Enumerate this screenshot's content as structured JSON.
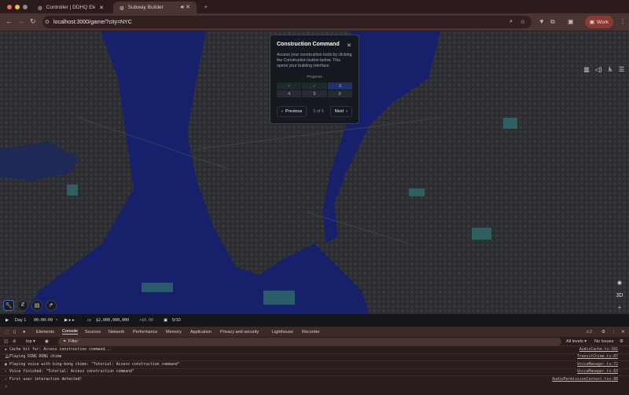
{
  "browser": {
    "tabs": [
      {
        "title": "Controller | DDHQ Election Vi",
        "active": false
      },
      {
        "title": "Subway Builder",
        "active": true
      }
    ],
    "url": "localhost:3000/game/?city=NYC",
    "profile": "Work"
  },
  "tutorial": {
    "title": "Construction Command",
    "body": "Access your construction tools by clicking the Construction button below. This opens your building interface.",
    "progress_label": "Progress",
    "steps": [
      "✓",
      "✓",
      "3",
      "4",
      "5",
      "6"
    ],
    "current_step": 3,
    "total_steps": 6,
    "counter": "3 of 6",
    "prev": "Previous",
    "next": "Next"
  },
  "map_controls": {
    "view_3d": "3D",
    "zoom_in": "+",
    "zoom_out": "−"
  },
  "status": {
    "day": "Day 1",
    "time": "00:00:00",
    "money": "$2,000,000,000",
    "delta": "+$0.00",
    "ridership": "5/10"
  },
  "devtools": {
    "tabs": [
      "Elements",
      "Console",
      "Sources",
      "Network",
      "Performance",
      "Memory",
      "Application",
      "Privacy and security",
      "Lighthouse",
      "Recorder"
    ],
    "warnings": "2",
    "context": "top ▾",
    "filter_placeholder": "Filter",
    "levels": "All levels ▾",
    "issues": "No Issues",
    "logs": [
      {
        "msg": "Cache hit for: Access construction command...",
        "src": "AudioCache.ts:101"
      },
      {
        "msg": "Playing DING DONG chime",
        "src": "TransitChime.ts:87"
      },
      {
        "msg": "Playing voice with bing-bong chime: \"Tutorial: Access construction command\"",
        "src": "VoiceManager.ts:72"
      },
      {
        "msg": "Voice finished: \"Tutorial: Access construction command\"",
        "src": "VoiceManager.ts:83"
      },
      {
        "msg": "First user interaction detected!",
        "src": "AudioPermissionContext.tsx:88"
      }
    ],
    "prompt": ">"
  }
}
